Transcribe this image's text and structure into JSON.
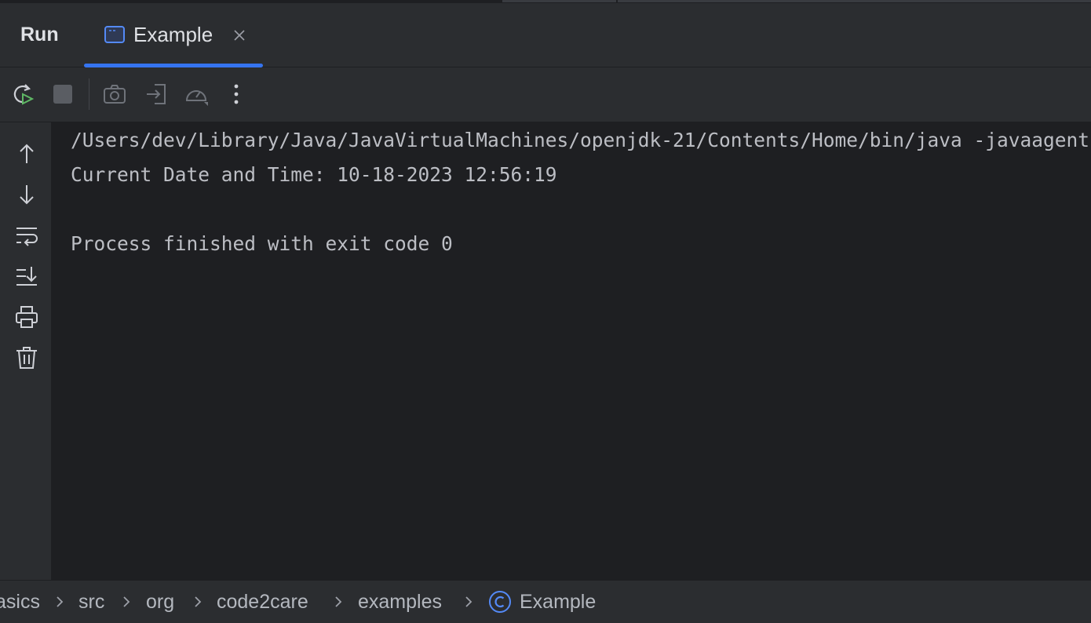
{
  "run_panel": {
    "title": "Run",
    "tab": {
      "label": "Example",
      "icon": "console-icon",
      "close_icon": "close-icon"
    }
  },
  "toolbar": {
    "buttons": [
      {
        "name": "rerun",
        "icon": "rerun-icon",
        "color": "#5fb865"
      },
      {
        "name": "stop",
        "icon": "stop-icon"
      },
      {
        "name": "screenshot",
        "icon": "camera-icon"
      },
      {
        "name": "restore-layout",
        "icon": "login-icon"
      },
      {
        "name": "profiler",
        "icon": "speedometer-icon"
      },
      {
        "name": "more",
        "icon": "more-vertical-icon"
      }
    ]
  },
  "gutter": {
    "buttons": [
      {
        "name": "up",
        "icon": "arrow-up-icon"
      },
      {
        "name": "down",
        "icon": "arrow-down-icon"
      },
      {
        "name": "soft-wrap",
        "icon": "soft-wrap-icon"
      },
      {
        "name": "scroll-to-end",
        "icon": "scroll-to-end-icon"
      },
      {
        "name": "print",
        "icon": "printer-icon"
      },
      {
        "name": "clear",
        "icon": "trash-icon"
      }
    ]
  },
  "console": {
    "lines": [
      "/Users/dev/Library/Java/JavaVirtualMachines/openjdk-21/Contents/Home/bin/java -javaagent:",
      "Current Date and Time: 10-18-2023 12:56:19",
      "",
      "Process finished with exit code 0"
    ]
  },
  "breadcrumb": {
    "items": [
      "asics",
      "src",
      "org",
      "code2care",
      "examples",
      "Example"
    ],
    "class_icon": "class-icon",
    "class_icon_color": "#548af7"
  },
  "colors": {
    "accent": "#3574f0",
    "background": "#2b2d30",
    "console_background": "#1e1f22",
    "text": "#bcbec4"
  }
}
